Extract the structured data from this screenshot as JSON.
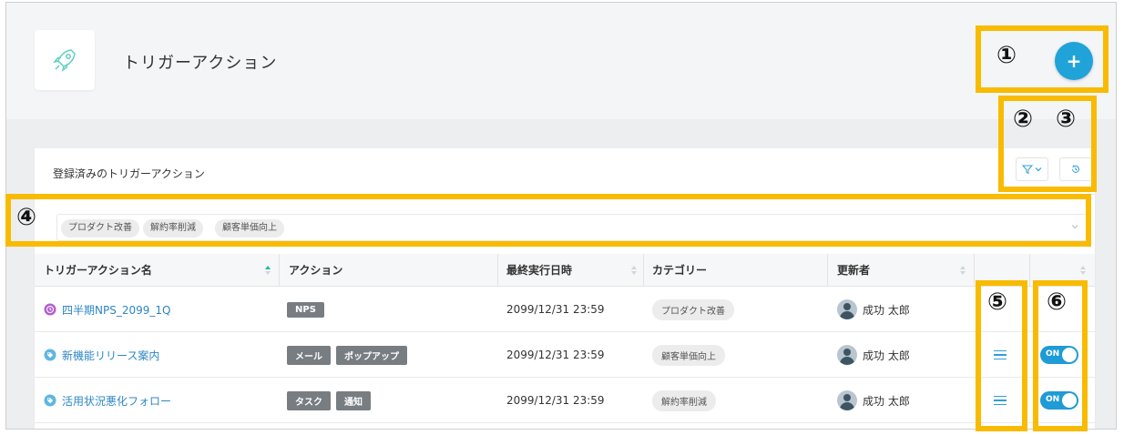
{
  "page": {
    "title": "トリガーアクション",
    "icon": "rocket-icon"
  },
  "header": {
    "add_button_label": "+"
  },
  "card": {
    "title": "登録済みのトリガーアクション",
    "filter_icon": "filter-icon",
    "history_icon": "history-icon"
  },
  "tag_filter": {
    "tags": [
      "プロダクト改善",
      "解約率削減",
      "顧客単価向上"
    ]
  },
  "table": {
    "headers": [
      "トリガーアクション名",
      "アクション",
      "最終実行日時",
      "カテゴリー",
      "更新者"
    ],
    "rows": [
      {
        "name": "四半期NPS_2099_1Q",
        "icon": "clock-icon",
        "actions": [
          "NPS"
        ],
        "last_run": "2099/12/31 23:59",
        "category": "プロダクト改善",
        "updater": "成功 太郎",
        "toggle": ""
      },
      {
        "name": "新機能リリース案内",
        "icon": "tag-icon",
        "actions": [
          "メール",
          "ポップアップ"
        ],
        "last_run": "2099/12/31 23:59",
        "category": "顧客単価向上",
        "updater": "成功 太郎",
        "toggle": "ON"
      },
      {
        "name": "活用状況悪化フォロー",
        "icon": "tag-icon",
        "actions": [
          "タスク",
          "通知"
        ],
        "last_run": "2099/12/31 23:59",
        "category": "解約率削減",
        "updater": "成功 太郎",
        "toggle": "ON"
      }
    ]
  },
  "annotations": [
    "①",
    "②",
    "③",
    "④",
    "⑤",
    "⑥"
  ],
  "colors": {
    "accent": "#20a3d8",
    "highlight": "#f8bb00",
    "link": "#2d86c4",
    "badge": "#787d82",
    "nps_icon": "#b25fd0",
    "tag_icon": "#5fb6df"
  }
}
